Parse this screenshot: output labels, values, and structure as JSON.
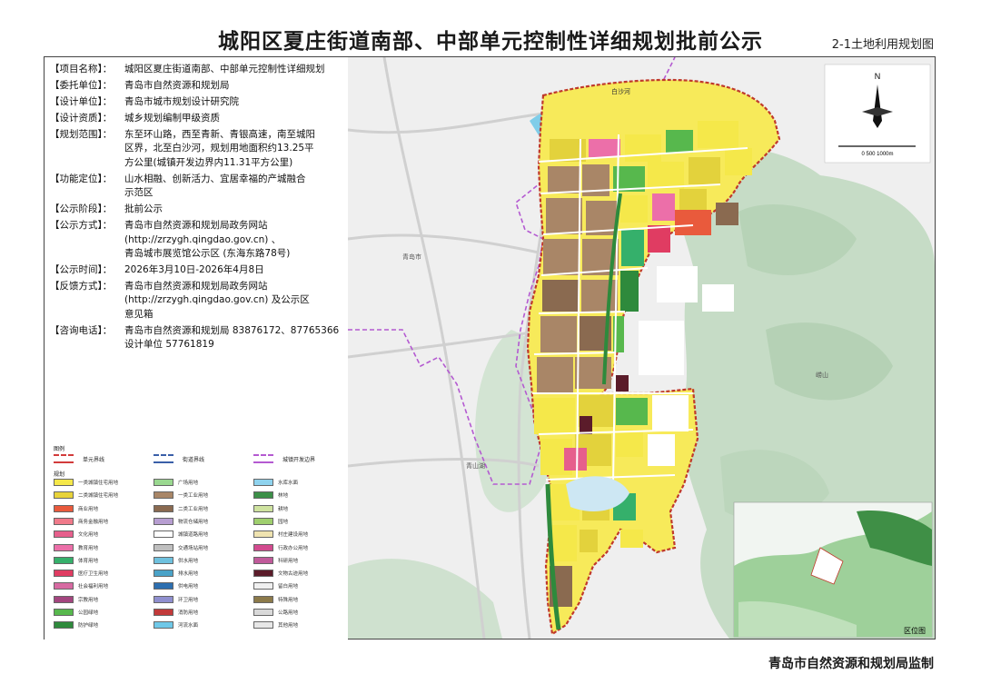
{
  "title": "城阳区夏庄街道南部、中部单元控制性详细规划批前公示",
  "map_no": "2-1土地利用规划图",
  "footer": "青岛市自然资源和规划局监制",
  "info": [
    {
      "key": "【项目名称】：",
      "lines": [
        "城阳区夏庄街道南部、中部单元控制性详细规划"
      ]
    },
    {
      "key": "【委托单位】：",
      "lines": [
        "青岛市自然资源和规划局"
      ]
    },
    {
      "key": "【设计单位】：",
      "lines": [
        "青岛市城市规划设计研究院"
      ]
    },
    {
      "key": "【设计资质】：",
      "lines": [
        "城乡规划编制甲级资质"
      ]
    },
    {
      "key": "【规划范围】：",
      "lines": [
        "东至环山路，西至青新、青银高速，南至城阳",
        "区界，北至白沙河，规划用地面积约13.25平",
        "方公里(城镇开发边界内11.31平方公里)"
      ]
    },
    {
      "key": "【功能定位】：",
      "lines": [
        "山水相融、创新活力、宜居幸福的产城融合",
        "示范区"
      ]
    },
    {
      "key": "【公示阶段】：",
      "lines": [
        "批前公示"
      ]
    },
    {
      "key": "【公示方式】：",
      "lines": [
        "青岛市自然资源和规划局政务网站",
        "(http://zrzygh.qingdao.gov.cn) 、",
        "青岛城市展览馆公示区 (东海东路78号)"
      ]
    },
    {
      "key": "【公示时间】：",
      "lines": [
        "2026年3月10日-2026年4月8日"
      ]
    },
    {
      "key": "【反馈方式】：",
      "lines": [
        "青岛市自然资源和规划局政务网站",
        "(http://zrzygh.qingdao.gov.cn) 及公示区",
        "意见箱"
      ]
    },
    {
      "key": "【咨询电话】：",
      "lines": [
        "青岛市自然资源和规划局 83876172、87765366",
        "设计单位                    57761819"
      ]
    }
  ],
  "legend": {
    "head": "图例",
    "sub": "规划",
    "top_items": [
      {
        "label": "单元界线",
        "color": "#d23b3b"
      },
      {
        "label": "街道界线",
        "color": "#3a5fa8"
      },
      {
        "label": "城镇开发边界",
        "color": "#b45ad1"
      }
    ],
    "items": [
      {
        "label": "一类城镇住宅用地",
        "color": "#f5e84a"
      },
      {
        "label": "二类城镇住宅用地",
        "color": "#e8d33a"
      },
      {
        "label": "商业用地",
        "color": "#e95a3c"
      },
      {
        "label": "商务金融用地",
        "color": "#f07a8a"
      },
      {
        "label": "文化用地",
        "color": "#e65f8c"
      },
      {
        "label": "教育用地",
        "color": "#ec6fa9"
      },
      {
        "label": "体育用地",
        "color": "#35b06b"
      },
      {
        "label": "医疗卫生用地",
        "color": "#e03c62"
      },
      {
        "label": "社会福利用地",
        "color": "#d76aa2"
      },
      {
        "label": "宗教用地",
        "color": "#a3457f"
      },
      {
        "label": "公园绿地",
        "color": "#57b84d"
      },
      {
        "label": "防护绿地",
        "color": "#2e8a3c"
      },
      {
        "label": "广场用地",
        "color": "#9ad890"
      },
      {
        "label": "一类工业用地",
        "color": "#a98667"
      },
      {
        "label": "二类工业用地",
        "color": "#8a6a50"
      },
      {
        "label": "物流仓储用地",
        "color": "#b79ed1"
      },
      {
        "label": "城镇道路用地",
        "color": "#ffffff"
      },
      {
        "label": "交通场站用地",
        "color": "#bfbfbf"
      },
      {
        "label": "供水用地",
        "color": "#6fc1de"
      },
      {
        "label": "排水用地",
        "color": "#4aa3c8"
      },
      {
        "label": "供电用地",
        "color": "#2d6fb0"
      },
      {
        "label": "环卫用地",
        "color": "#8f8fcf"
      },
      {
        "label": "消防用地",
        "color": "#c23a3a"
      },
      {
        "label": "河流水面",
        "color": "#6fc8e8"
      },
      {
        "label": "水库水面",
        "color": "#8fd3ee"
      },
      {
        "label": "林地",
        "color": "#3c8f48"
      },
      {
        "label": "耕地",
        "color": "#cfe3a0"
      },
      {
        "label": "园地",
        "color": "#9fcf6e"
      },
      {
        "label": "村庄建设用地",
        "color": "#efe3b0"
      },
      {
        "label": "行政办公用地",
        "color": "#d24b8f"
      },
      {
        "label": "科研用地",
        "color": "#c05a9a"
      },
      {
        "label": "文物古迹用地",
        "color": "#5b1c2a"
      },
      {
        "label": "留白用地",
        "color": "#f0f0f0"
      },
      {
        "label": "特殊用地",
        "color": "#8c7a4a"
      },
      {
        "label": "公路用地",
        "color": "#d9d9d9"
      },
      {
        "label": "其他用地",
        "color": "#e7e7e7"
      }
    ]
  },
  "map": {
    "labels": [
      "白沙河",
      "青岛市",
      "崂山",
      "青山湖",
      "区位图"
    ],
    "north": "N",
    "scale_text": "0  500  1000m",
    "colors": {
      "land_bg": "#eeeeee",
      "hills": "#c7ddc7",
      "river": "#7fcce8",
      "road": "#ffffff",
      "boundary": "#c0392b",
      "district_line": "#b45ad1"
    }
  }
}
